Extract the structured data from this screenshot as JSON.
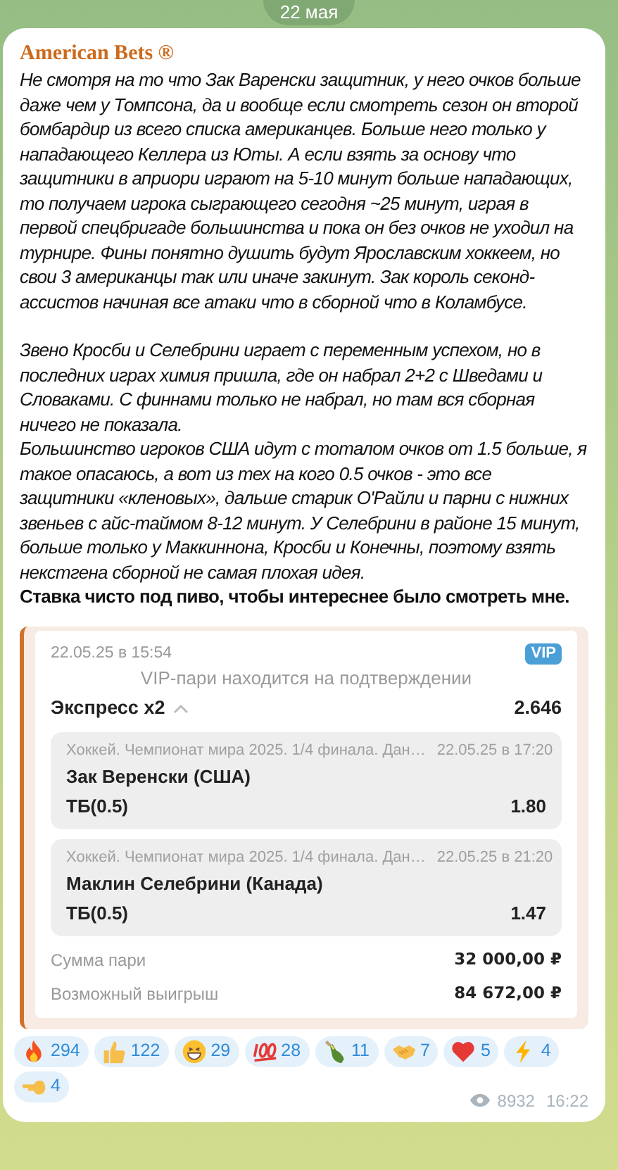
{
  "date_badge": "22 мая",
  "message": {
    "author": "American Bets ®",
    "sections": [
      {
        "paragraphs": [
          {
            "kind": "italic",
            "text": "Не смотря на то что Зак Варенски защитник, у него очков больше даже чем у Томпсона, да и вообще если смотреть сезон он второй бомбардир из всего списка американцев. Больше него только у нападающего Келлера из Юты. А если взять за основу что защитники в априори играют на 5-10 минут больше нападающих, то получаем игрока сыграющего сегодня ~25 минут, играя в первой спецбригаде большинства и пока он без очков не уходил на турнире. Фины понятно душить будут Ярославским хоккеем, но свои 3 американцы так или иначе закинут. Зак король секонд-ассистов начиная все атаки что в сборной что в Коламбусе."
          }
        ]
      },
      {
        "paragraphs": [
          {
            "kind": "italic",
            "text": "Звено Кросби и Селебрини играет с переменным успехом, но в последних играх химия пришла, где он набрал 2+2 с Шведами и Словаками. С финнами только не набрал, но там вся сборная ничего не показала."
          },
          {
            "kind": "italic",
            "text": "Большинство игроков США идут с тоталом очков от 1.5 больше, я такое опасаюсь, а вот из тех на кого 0.5 очков - это все защитники «кленовых», дальше старик О'Райли и парни с нижних звеньев с айс-таймом 8-12 минут. У Селебрини в районе 15 минут, больше только у Маккиннона, Кросби и Конечны, поэтому взять некстгена сборной не самая плохая идея."
          },
          {
            "kind": "bold",
            "text": "Ставка чисто под пиво, чтобы интереснее было смотреть мне."
          }
        ]
      }
    ],
    "bet_card": {
      "timestamp": "22.05.25 в 15:54",
      "badge": "VIP",
      "status": "VIP-пари находится на подтверждении",
      "title": "Экспресс x2",
      "expanded": true,
      "total_odds": "2.646",
      "events": [
        {
          "league": "Хоккей. Чемпионат мира 2025. 1/4 финала. Дан…",
          "time": "22.05.25 в 17:20",
          "player": "Зак Веренски (США)",
          "market": "ТБ(0.5)",
          "odds": "1.80"
        },
        {
          "league": "Хоккей. Чемпионат мира 2025. 1/4 финала. Дан…",
          "time": "22.05.25 в 21:20",
          "player": "Маклин Селебрини (Канада)",
          "market": "ТБ(0.5)",
          "odds": "1.47"
        }
      ],
      "summary": [
        {
          "label": "Сумма пари",
          "value": "32 000,00 ₽"
        },
        {
          "label": "Возможный выигрыш",
          "value": "84 672,00 ₽"
        }
      ]
    },
    "reactions": [
      {
        "kind": "fire",
        "count": "294"
      },
      {
        "kind": "thumbs_up",
        "count": "122"
      },
      {
        "kind": "grin",
        "count": "29"
      },
      {
        "kind": "hundred",
        "count": "28"
      },
      {
        "kind": "bottle",
        "count": "11"
      },
      {
        "kind": "handshake",
        "count": "7"
      },
      {
        "kind": "heart",
        "count": "5"
      },
      {
        "kind": "lightning",
        "count": "4"
      },
      {
        "kind": "pointing",
        "count": "4"
      }
    ],
    "views": "8932",
    "time": "16:22"
  }
}
